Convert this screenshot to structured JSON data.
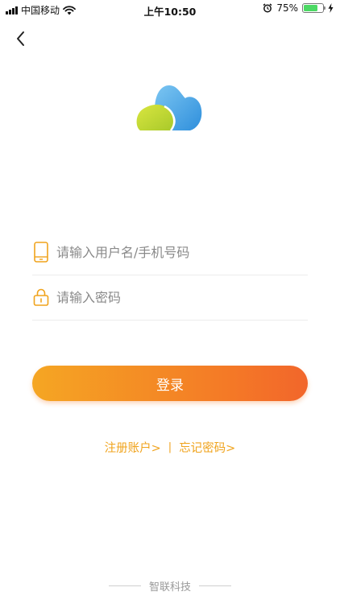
{
  "status_bar": {
    "carrier": "中国移动",
    "time": "上午10:50",
    "battery_percent": "75%",
    "battery_level": 0.75,
    "battery_color": "#4cd964"
  },
  "nav": {
    "back_icon": "chevron-left-icon"
  },
  "logo": {
    "icon": "cloud-logo-icon",
    "colors": [
      "#c6d932",
      "#49a6e6"
    ]
  },
  "form": {
    "username": {
      "icon": "phone-icon",
      "placeholder": "请输入用户名/手机号码",
      "value": ""
    },
    "password": {
      "icon": "lock-icon",
      "placeholder": "请输入密码",
      "value": ""
    },
    "login_label": "登录"
  },
  "links": {
    "register": "注册账户>",
    "separator": "|",
    "forgot": "忘记密码>"
  },
  "footer": {
    "company": "智联科技"
  },
  "colors": {
    "accent": "#f0a31c",
    "button_start": "#f5a623",
    "button_end": "#f2662b"
  }
}
